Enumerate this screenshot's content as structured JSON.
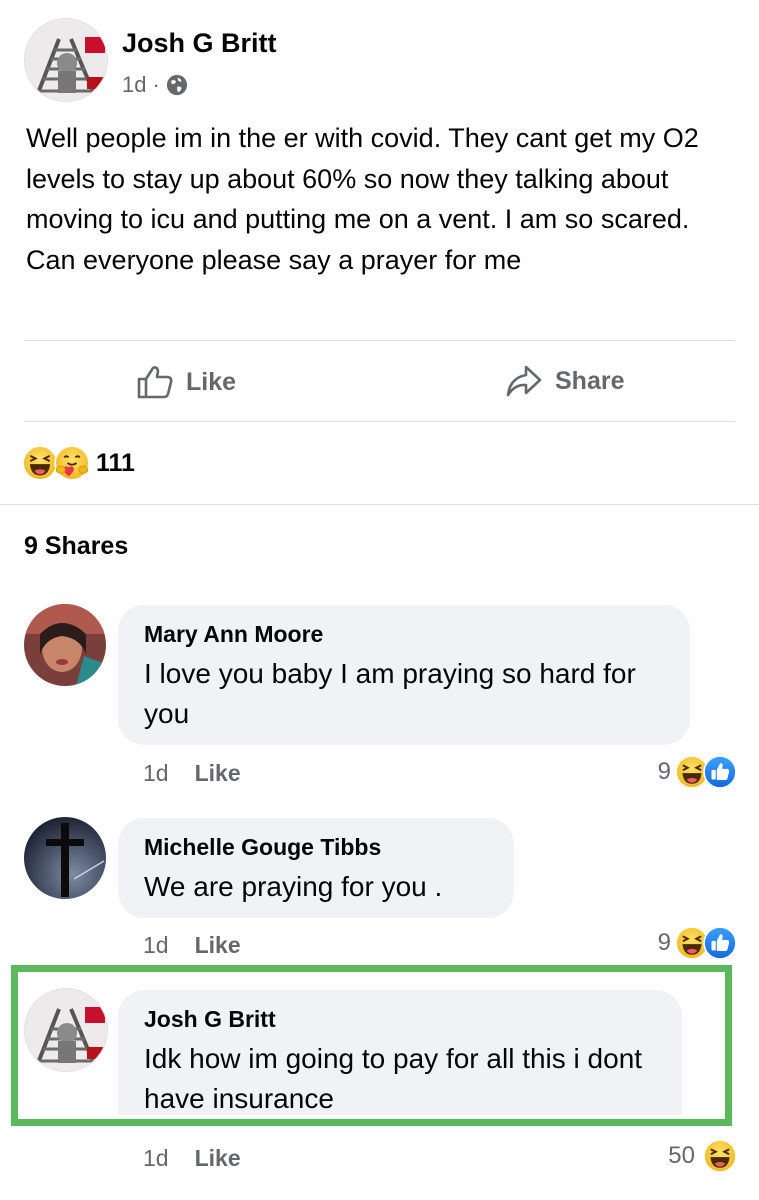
{
  "post": {
    "author": "Josh G Britt",
    "time": "1d",
    "dot": "·",
    "privacy_icon": "globe-icon",
    "text": "Well people im in the er with covid. They cant get my O2 levels to stay up about 60% so now they talking about moving to icu and putting me on a vent. I am so scared. Can everyone please say a prayer for me"
  },
  "actions": {
    "like_label": "Like",
    "share_label": "Share"
  },
  "reactions": {
    "icons": [
      "laugh-emoji-icon",
      "care-emoji-icon"
    ],
    "count": "111"
  },
  "shares": "9 Shares",
  "comments": [
    {
      "author": "Mary Ann Moore",
      "text": "I love you baby I am praying so hard for you",
      "time": "1d",
      "like_label": "Like",
      "reaction_count": "9",
      "reaction_icons": [
        "laugh-emoji-icon",
        "like-emoji-icon"
      ]
    },
    {
      "author": "Michelle Gouge Tibbs",
      "text": "We are praying for you .",
      "time": "1d",
      "like_label": "Like",
      "reaction_count": "9",
      "reaction_icons": [
        "laugh-emoji-icon",
        "like-emoji-icon"
      ]
    },
    {
      "author": "Josh G Britt",
      "text": "Idk how im going to pay for all this i dont have insurance",
      "time": "1d",
      "like_label": "Like",
      "reaction_count": "50",
      "reaction_icons": [
        "laugh-emoji-icon"
      ]
    }
  ],
  "colors": {
    "highlight": "#5cb85c",
    "bubble": "#f0f2f5",
    "muted_text": "#65676b",
    "like_blue": "#1877f2"
  }
}
